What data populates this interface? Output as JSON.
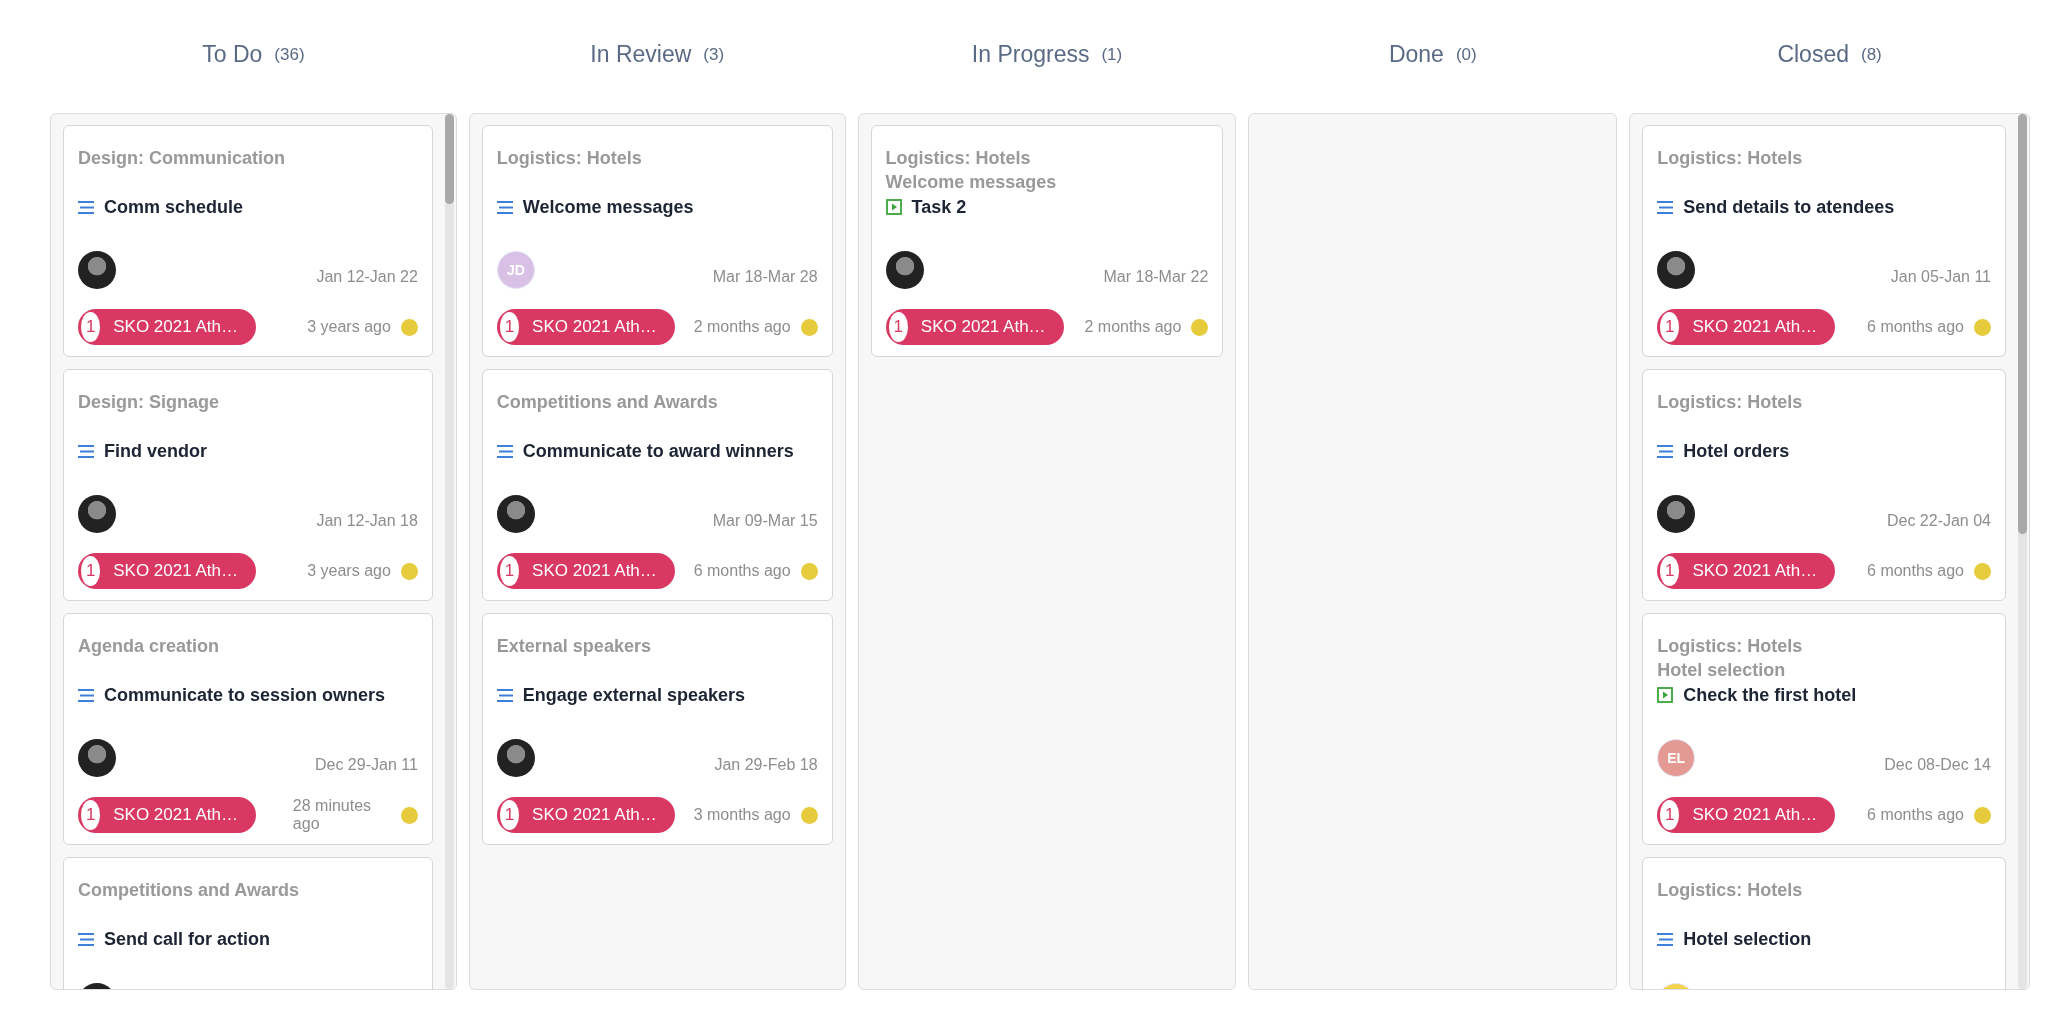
{
  "columns": [
    {
      "title": "To Do",
      "count": "(36)",
      "scrollable": true,
      "cards": [
        {
          "groups": [
            "Design: Communication"
          ],
          "kind": "task",
          "title": "Comm schedule",
          "avatar": {
            "kind": "photo"
          },
          "dates": "Jan 12-Jan 22",
          "tag": {
            "number": "1",
            "label": "SKO 2021 Ath…"
          },
          "updated": "3 years ago"
        },
        {
          "groups": [
            "Design: Signage"
          ],
          "kind": "task",
          "title": "Find vendor",
          "avatar": {
            "kind": "photo"
          },
          "dates": "Jan 12-Jan 18",
          "tag": {
            "number": "1",
            "label": "SKO 2021 Ath…"
          },
          "updated": "3 years ago"
        },
        {
          "groups": [
            "Agenda creation"
          ],
          "kind": "task",
          "title": "Communicate to session owners",
          "avatar": {
            "kind": "photo"
          },
          "dates": "Dec 29-Jan 11",
          "tag": {
            "number": "1",
            "label": "SKO 2021 Ath…"
          },
          "updated": "28 minutes ago"
        },
        {
          "groups": [
            "Competitions and Awards"
          ],
          "kind": "task",
          "title": "Send call for action",
          "avatar": {
            "kind": "photo"
          }
        }
      ]
    },
    {
      "title": "In Review",
      "count": "(3)",
      "scrollable": false,
      "cards": [
        {
          "groups": [
            "Logistics: Hotels"
          ],
          "kind": "task",
          "title": "Welcome messages",
          "avatar": {
            "kind": "initials",
            "initials": "JD",
            "color": "#d9c1e6"
          },
          "dates": "Mar 18-Mar 28",
          "tag": {
            "number": "1",
            "label": "SKO 2021 Ath…"
          },
          "updated": "2 months ago"
        },
        {
          "groups": [
            "Competitions and Awards"
          ],
          "kind": "task",
          "title": "Communicate to award winners",
          "avatar": {
            "kind": "photo"
          },
          "dates": "Mar 09-Mar 15",
          "tag": {
            "number": "1",
            "label": "SKO 2021 Ath…"
          },
          "updated": "6 months ago"
        },
        {
          "groups": [
            "External speakers"
          ],
          "kind": "task",
          "title": "Engage external speakers",
          "avatar": {
            "kind": "photo"
          },
          "dates": "Jan 29-Feb 18",
          "tag": {
            "number": "1",
            "label": "SKO 2021 Ath…"
          },
          "updated": "3 months ago"
        }
      ]
    },
    {
      "title": "In Progress",
      "count": "(1)",
      "scrollable": false,
      "cards": [
        {
          "groups": [
            "Logistics: Hotels",
            "Welcome messages"
          ],
          "kind": "subtask",
          "title": "Task 2",
          "avatar": {
            "kind": "photo"
          },
          "dates": "Mar 18-Mar 22",
          "tag": {
            "number": "1",
            "label": "SKO 2021 Ath…"
          },
          "updated": "2 months ago"
        }
      ]
    },
    {
      "title": "Done",
      "count": "(0)",
      "scrollable": false
    },
    {
      "title": "Closed",
      "count": "(8)",
      "scrollable": true,
      "cards": [
        {
          "groups": [
            "Logistics: Hotels"
          ],
          "kind": "task",
          "title": "Send details to atendees",
          "avatar": {
            "kind": "photo"
          },
          "dates": "Jan 05-Jan 11",
          "tag": {
            "number": "1",
            "label": "SKO 2021 Ath…"
          },
          "updated": "6 months ago"
        },
        {
          "groups": [
            "Logistics: Hotels"
          ],
          "kind": "task",
          "title": "Hotel orders",
          "avatar": {
            "kind": "photo"
          },
          "dates": "Dec 22-Jan 04",
          "tag": {
            "number": "1",
            "label": "SKO 2021 Ath…"
          },
          "updated": "6 months ago"
        },
        {
          "groups": [
            "Logistics: Hotels",
            "Hotel selection"
          ],
          "kind": "subtask",
          "title": "Check the first hotel",
          "avatar": {
            "kind": "initials",
            "initials": "EL",
            "color": "#e49a93"
          },
          "dates": "Dec 08-Dec 14",
          "tag": {
            "number": "1",
            "label": "SKO 2021 Ath…"
          },
          "updated": "6 months ago"
        },
        {
          "groups": [
            "Logistics: Hotels"
          ],
          "kind": "task",
          "title": "Hotel selection",
          "avatar": {
            "kind": "initials",
            "color": "#f2d34c"
          }
        }
      ]
    }
  ]
}
